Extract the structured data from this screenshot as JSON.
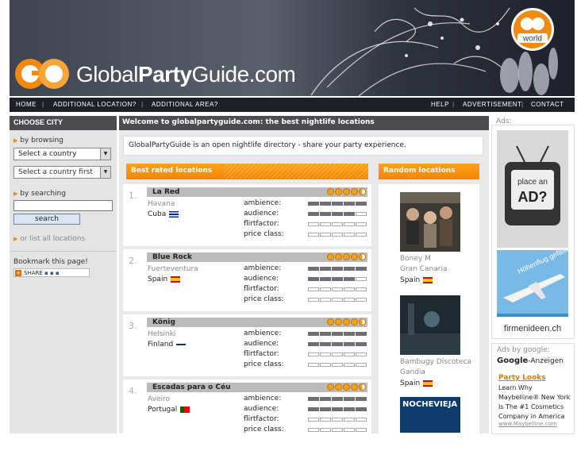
{
  "header": {
    "logo_prefix": "Global",
    "logo_bold": "Party",
    "logo_suffix": "Guide.com",
    "badge_text": "world"
  },
  "nav": {
    "left": [
      "HOME",
      "ADDITIONAL LOCATION?",
      "ADDITIONAL AREA?"
    ],
    "right": [
      "HELP",
      "ADVERTISEMENT",
      "CONTACT"
    ]
  },
  "sidebar": {
    "title": "CHOOSE CITY",
    "browse_label": "by browsing",
    "select_country": "Select a country",
    "select_country_first": "Select a country first",
    "search_label": "by searching",
    "search_button": "search",
    "list_all": "or list all locations",
    "bookmark": "Bookmark this page!",
    "share": "SHARE"
  },
  "main": {
    "welcome": "Welcome to globalpartyguide.com: the best nightlife locations",
    "intro": "GlobalPartyGuide is an open nightlife directory - share your party experience.",
    "best_title": "Best rated locations",
    "random_title": "Random locations",
    "attr_labels": [
      "ambience:",
      "audience:",
      "flirtfactor:",
      "price class:"
    ],
    "locations": [
      {
        "num": "1.",
        "name": "La Red",
        "city": "Havana",
        "country": "Cuba",
        "rating": 4.5,
        "meters": [
          5,
          4,
          0,
          0
        ]
      },
      {
        "num": "2.",
        "name": "Blue Rock",
        "city": "Fuerteventura",
        "country": "Spain",
        "rating": 4.5,
        "meters": [
          5,
          4,
          0,
          0
        ]
      },
      {
        "num": "3.",
        "name": "König",
        "city": "Helsinki",
        "country": "Finland",
        "rating": 4.5,
        "meters": [
          5,
          5,
          0,
          0
        ]
      },
      {
        "num": "4.",
        "name": "Escadas para o Céu",
        "city": "Aveiro",
        "country": "Portugal",
        "rating": 4.5,
        "meters": [
          5,
          5,
          0,
          0
        ]
      }
    ],
    "random": [
      {
        "caption1": "Boney M",
        "caption2": "Gran Canaria",
        "country": "Spain"
      },
      {
        "caption1": "Bambugy Discoteca",
        "caption2": "Gandia",
        "country": "Spain"
      },
      {
        "caption1": "NOCHEVIEJA"
      }
    ]
  },
  "ads": {
    "label": "Ads:",
    "ad1_text1": "place an",
    "ad1_text2": "AD?",
    "ad2_brand": "firmenideen.ch",
    "ad2_text": "Höhenflug gefällig?",
    "google_label": "Ads by google:",
    "google_brand": "Google",
    "google_suffix": "-Anzeigen",
    "ad_title": "Party Looks",
    "ad_body": "Learn Why Maybelline® New York Is The #1 Cosmetics Company in America",
    "ad_url": "www.Maybelline.com"
  }
}
